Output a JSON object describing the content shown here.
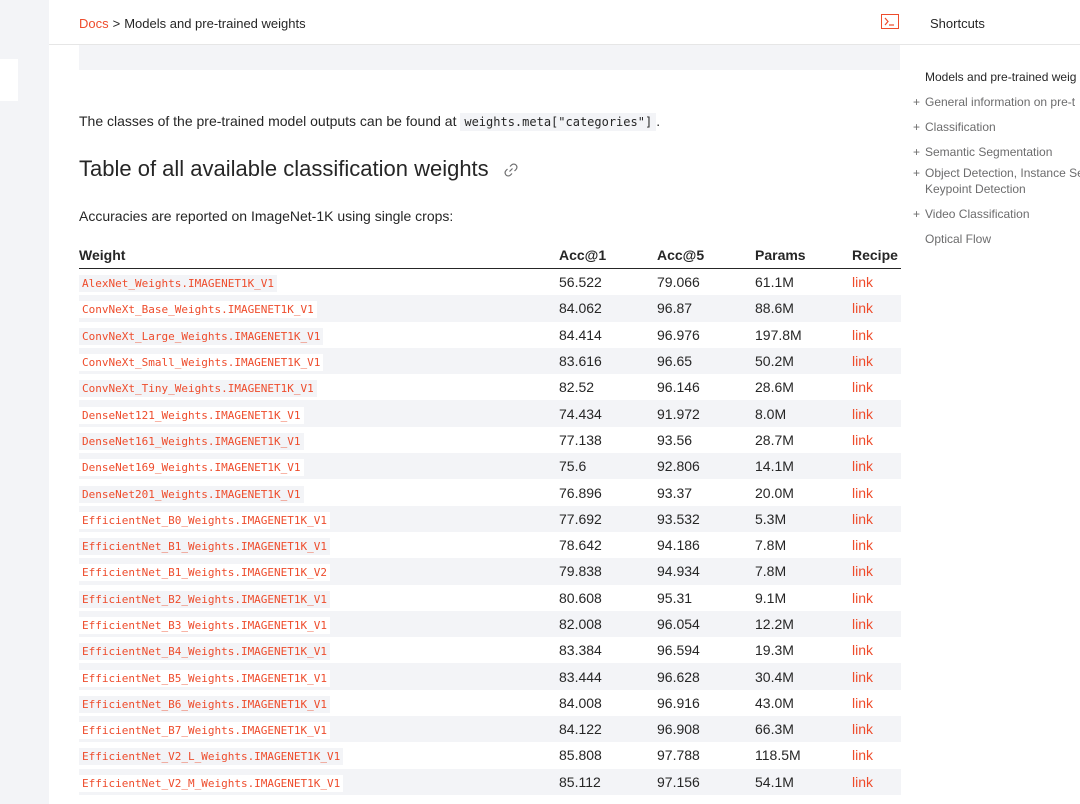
{
  "breadcrumb": {
    "root": "Docs",
    "separator": ">",
    "current": "Models and pre-trained weights"
  },
  "shortcuts": {
    "label": "Shortcuts"
  },
  "content": {
    "classes_text_before": "The classes of the pre-trained model outputs can be found at ",
    "classes_code": "weights.meta[\"categories\"]",
    "classes_text_after": ".",
    "section_title": "Table of all available classification weights",
    "accuracy_text": "Accuracies are reported on ImageNet-1K using single crops:"
  },
  "table": {
    "headers": [
      "Weight",
      "Acc@1",
      "Acc@5",
      "Params",
      "Recipe"
    ],
    "rows": [
      {
        "weight": "AlexNet_Weights.IMAGENET1K_V1",
        "acc1": "56.522",
        "acc5": "79.066",
        "params": "61.1M",
        "recipe": "link"
      },
      {
        "weight": "ConvNeXt_Base_Weights.IMAGENET1K_V1",
        "acc1": "84.062",
        "acc5": "96.87",
        "params": "88.6M",
        "recipe": "link"
      },
      {
        "weight": "ConvNeXt_Large_Weights.IMAGENET1K_V1",
        "acc1": "84.414",
        "acc5": "96.976",
        "params": "197.8M",
        "recipe": "link"
      },
      {
        "weight": "ConvNeXt_Small_Weights.IMAGENET1K_V1",
        "acc1": "83.616",
        "acc5": "96.65",
        "params": "50.2M",
        "recipe": "link"
      },
      {
        "weight": "ConvNeXt_Tiny_Weights.IMAGENET1K_V1",
        "acc1": "82.52",
        "acc5": "96.146",
        "params": "28.6M",
        "recipe": "link"
      },
      {
        "weight": "DenseNet121_Weights.IMAGENET1K_V1",
        "acc1": "74.434",
        "acc5": "91.972",
        "params": "8.0M",
        "recipe": "link"
      },
      {
        "weight": "DenseNet161_Weights.IMAGENET1K_V1",
        "acc1": "77.138",
        "acc5": "93.56",
        "params": "28.7M",
        "recipe": "link"
      },
      {
        "weight": "DenseNet169_Weights.IMAGENET1K_V1",
        "acc1": "75.6",
        "acc5": "92.806",
        "params": "14.1M",
        "recipe": "link"
      },
      {
        "weight": "DenseNet201_Weights.IMAGENET1K_V1",
        "acc1": "76.896",
        "acc5": "93.37",
        "params": "20.0M",
        "recipe": "link"
      },
      {
        "weight": "EfficientNet_B0_Weights.IMAGENET1K_V1",
        "acc1": "77.692",
        "acc5": "93.532",
        "params": "5.3M",
        "recipe": "link"
      },
      {
        "weight": "EfficientNet_B1_Weights.IMAGENET1K_V1",
        "acc1": "78.642",
        "acc5": "94.186",
        "params": "7.8M",
        "recipe": "link"
      },
      {
        "weight": "EfficientNet_B1_Weights.IMAGENET1K_V2",
        "acc1": "79.838",
        "acc5": "94.934",
        "params": "7.8M",
        "recipe": "link"
      },
      {
        "weight": "EfficientNet_B2_Weights.IMAGENET1K_V1",
        "acc1": "80.608",
        "acc5": "95.31",
        "params": "9.1M",
        "recipe": "link"
      },
      {
        "weight": "EfficientNet_B3_Weights.IMAGENET1K_V1",
        "acc1": "82.008",
        "acc5": "96.054",
        "params": "12.2M",
        "recipe": "link"
      },
      {
        "weight": "EfficientNet_B4_Weights.IMAGENET1K_V1",
        "acc1": "83.384",
        "acc5": "96.594",
        "params": "19.3M",
        "recipe": "link"
      },
      {
        "weight": "EfficientNet_B5_Weights.IMAGENET1K_V1",
        "acc1": "83.444",
        "acc5": "96.628",
        "params": "30.4M",
        "recipe": "link"
      },
      {
        "weight": "EfficientNet_B6_Weights.IMAGENET1K_V1",
        "acc1": "84.008",
        "acc5": "96.916",
        "params": "43.0M",
        "recipe": "link"
      },
      {
        "weight": "EfficientNet_B7_Weights.IMAGENET1K_V1",
        "acc1": "84.122",
        "acc5": "96.908",
        "params": "66.3M",
        "recipe": "link"
      },
      {
        "weight": "EfficientNet_V2_L_Weights.IMAGENET1K_V1",
        "acc1": "85.808",
        "acc5": "97.788",
        "params": "118.5M",
        "recipe": "link"
      },
      {
        "weight": "EfficientNet_V2_M_Weights.IMAGENET1K_V1",
        "acc1": "85.112",
        "acc5": "97.156",
        "params": "54.1M",
        "recipe": "link"
      }
    ]
  },
  "toc": {
    "items": [
      {
        "label": "Models and pre-trained weig",
        "expandable": false,
        "active": true
      },
      {
        "label": "General information on pre-t",
        "expandable": true,
        "active": false
      },
      {
        "label": "Classification",
        "expandable": true,
        "active": false
      },
      {
        "label": "Semantic Segmentation",
        "expandable": true,
        "active": false
      },
      {
        "label": "Object Detection, Instance Se",
        "expandable": true,
        "active": false
      },
      {
        "label": "Keypoint Detection",
        "expandable": false,
        "active": false
      },
      {
        "label": "Video Classification",
        "expandable": true,
        "active": false
      },
      {
        "label": "Optical Flow",
        "expandable": false,
        "active": false
      }
    ]
  },
  "colors": {
    "accent": "#ee4c2c",
    "text": "#262626",
    "muted": "#6c6c6d",
    "stripe": "#f3f4f7"
  },
  "icons": {
    "shortcuts": "terminal-icon",
    "anchor": "link-icon"
  }
}
